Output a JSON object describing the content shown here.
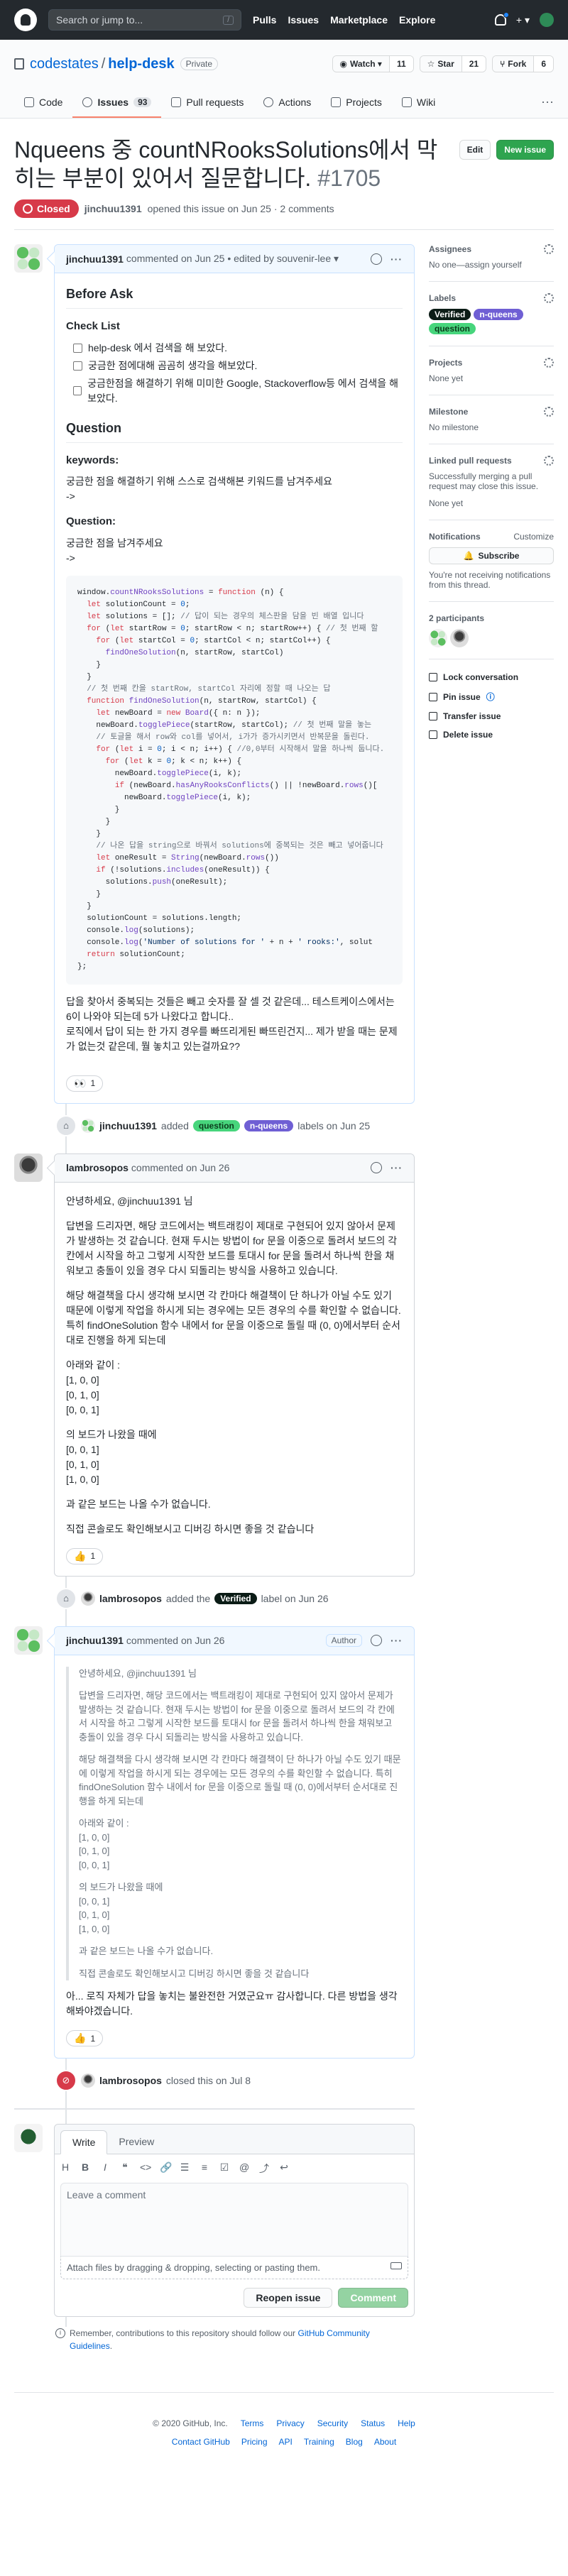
{
  "header": {
    "search_placeholder": "Search or jump to...",
    "search_key": "/",
    "nav": [
      "Pulls",
      "Issues",
      "Marketplace",
      "Explore"
    ],
    "plus": "+ ▾"
  },
  "repo": {
    "owner": "codestates",
    "sep": "/",
    "name": "help-desk",
    "visibility": "Private",
    "watch_label": "Watch ▾",
    "watch_count": "11",
    "star_label": "Star",
    "star_count": "21",
    "fork_label": "Fork",
    "fork_count": "6",
    "tabs": [
      {
        "label": "Code"
      },
      {
        "label": "Issues",
        "count": "93"
      },
      {
        "label": "Pull requests"
      },
      {
        "label": "Actions"
      },
      {
        "label": "Projects"
      },
      {
        "label": "Wiki"
      }
    ],
    "more": "···"
  },
  "issue": {
    "title": "Nqueens 중 countNRooksSolutions에서 막히는 부분이 있어서 질문합니다.",
    "number": "#1705",
    "edit_label": "Edit",
    "new_issue_label": "New issue",
    "state": "Closed",
    "author": "jinchuu1391",
    "opened_text": "opened this issue on Jun 25 · 2 comments"
  },
  "comments": {
    "c1": {
      "author": "jinchuu1391",
      "meta": "commented on Jun 25 • edited by souvenir-lee ▾",
      "before_ask": "Before Ask",
      "checklist_title": "Check List",
      "checklist": [
        "help-desk 에서 검색을 해 보았다.",
        "궁금한 점에대해 곰곰히 생각을 해보았다.",
        "궁금한점을 해결하기 위해 미미한 Google, Stackoverflow등 에서 검색을 해보았다."
      ],
      "question_h": "Question",
      "keywords_h": "keywords:",
      "keywords_p1": "궁금한 점을 해결하기 위해 스스로 검색해본 키워드를 남겨주세요",
      "keywords_p2": "->",
      "question_sub": "Question:",
      "question_p1": "궁금한 점을 남겨주세요",
      "question_p2": "->",
      "after1": "답을 찾아서 중복되는 것들은 빼고 숫자를 잘 셀 것 같은데... 테스트케이스에서는 6이 나와야 되는데 5가 나왔다고 합니다..",
      "after2": "로직에서 답이 되는 한 가지 경우를 빠뜨리게된 빠뜨린건지... 제가 받을 때는 문제가 없는것 같은데, 뭘 놓치고 있는걸까요??",
      "reaction_emoji": "👀",
      "reaction_count": "1"
    },
    "e1": {
      "author": "jinchuu1391",
      "action": "added",
      "labels": [
        "question",
        "n-queens"
      ],
      "tail": "labels on Jun 25"
    },
    "c2": {
      "author": "lambrosopos",
      "meta": "commented on Jun 26",
      "p1": "안녕하세요, @jinchuu1391 님",
      "p2": "답변을 드리자면, 해당 코드에서는 백트래킹이 제대로 구현되어 있지 않아서 문제가 발생하는 것 같습니다. 현재 두시는 방법이 for 문을 이중으로 돌려서 보드의 각 칸에서 시작을 하고 그렇게 시작한 보드를 토대시 for 문을 돌려서 하나씩 한을 채워보고 충돌이 있을 경우 다시 되돌리는 방식을 사용하고 있습니다.",
      "p3": "해당 해결책을 다시 생각해 보시면 각 칸마다 해결책이 단 하나가 아닐 수도 있기 때문에 이렇게 작업을 하시게 되는 경우에는 모든 경우의 수를 확인할 수 없습니다. 특히 findOneSolution 함수 내에서 for 문을 이중으로 돌릴 때 (0, 0)에서부터 순서대로 진행을 하게 되는데",
      "p4": "아래와 같이 :",
      "p4_lines": [
        "[1, 0, 0]",
        "[0, 1, 0]",
        "[0, 0, 1]"
      ],
      "p5": "의 보드가 나왔을 때에",
      "p5_lines": [
        "[0, 0, 1]",
        "[0, 1, 0]",
        "[1, 0, 0]"
      ],
      "p6": "과 같은 보드는 나올 수가 없습니다.",
      "p7": "직접 콘솔로도 확인해보시고 디버깅 하시면 좋을 것 같습니다",
      "reaction_emoji": "👍",
      "reaction_count": "1"
    },
    "e2": {
      "author": "lambrosopos",
      "action": "added the",
      "label": "Verified",
      "tail": "label on Jun 26"
    },
    "c3": {
      "author": "jinchuu1391",
      "meta": "commented on Jun 26",
      "badge": "Author",
      "q1": "안녕하세요, @jinchuu1391 님",
      "q2": "답변을 드리자면, 해당 코드에서는 백트래킹이 제대로 구현되어 있지 않아서 문제가 발생하는 것 같습니다. 현재 두시는 방법이 for 문을 이중으로 돌려서 보드의 각 칸에서 시작을 하고 그렇게 시작한 보드를 토대시 for 문을 돌려서 하나씩 한을 채워보고 충돌이 있을 경우 다시 되돌리는 방식을 사용하고 있습니다.",
      "q3": "해당 해결책을 다시 생각해 보시면 각 칸마다 해결책이 단 하나가 아닐 수도 있기 때문에 이렇게 작업을 하시게 되는 경우에는 모든 경우의 수를 확인할 수 없습니다. 특히 findOneSolution 함수 내에서 for 문을 이중으로 돌릴 때 (0, 0)에서부터 순서대로 진행을 하게 되는데",
      "q4": "아래와 같이 :",
      "q4_lines": [
        "[1, 0, 0]",
        "[0, 1, 0]",
        "[0, 0, 1]"
      ],
      "q5": "의 보드가 나왔을 때에",
      "q5_lines": [
        "[0, 0, 1]",
        "[0, 1, 0]",
        "[1, 0, 0]"
      ],
      "q6": "과 같은 보드는 나올 수가 없습니다.",
      "q7": "직접 콘솔로도 확인해보시고 디버깅 하시면 좋을 것 같습니다",
      "reply": "아... 로직 자체가 답을 놓치는 불완전한 거였군요ㅠ 감사합니다. 다른 방법을 생각해봐야겠습니다.",
      "reaction_emoji": "👍",
      "reaction_count": "1"
    },
    "e3": {
      "author": "lambrosopos",
      "tail": "closed this on Jul 8"
    }
  },
  "composer": {
    "tab_write": "Write",
    "tab_preview": "Preview",
    "placeholder": "Leave a comment",
    "attach": "Attach files by dragging & dropping, selecting or pasting them.",
    "reopen": "Reopen issue",
    "comment": "Comment",
    "remember_pre": "Remember, contributions to this repository should follow our",
    "remember_link": "GitHub Community Guidelines",
    "remember_post": "."
  },
  "sidebar": {
    "assignees_h": "Assignees",
    "assignees_v": "No one—assign yourself",
    "labels_h": "Labels",
    "labels": [
      "Verified",
      "n-queens",
      "question"
    ],
    "projects_h": "Projects",
    "projects_v": "None yet",
    "milestone_h": "Milestone",
    "milestone_v": "No milestone",
    "linked_h": "Linked pull requests",
    "linked_desc": "Successfully merging a pull request may close this issue.",
    "linked_v": "None yet",
    "notif_h": "Notifications",
    "notif_customize": "Customize",
    "subscribe": "Subscribe",
    "notif_desc": "You're not receiving notifications from this thread.",
    "participants_h": "2 participants",
    "actions": [
      "Lock conversation",
      "Pin issue",
      "Transfer issue",
      "Delete issue"
    ],
    "pin_new": "ⓘ"
  },
  "footer": {
    "copyright": "© 2020 GitHub, Inc.",
    "row1": [
      "Terms",
      "Privacy",
      "Security",
      "Status",
      "Help"
    ],
    "row2": [
      "Contact GitHub",
      "Pricing",
      "API",
      "Training",
      "Blog",
      "About"
    ]
  },
  "colors": {
    "closed": "#d73a49",
    "new_issue": "#2ea44f",
    "verified": "#0b1c16",
    "n_queens": "#6f5fd4",
    "question": "#47d57c"
  }
}
